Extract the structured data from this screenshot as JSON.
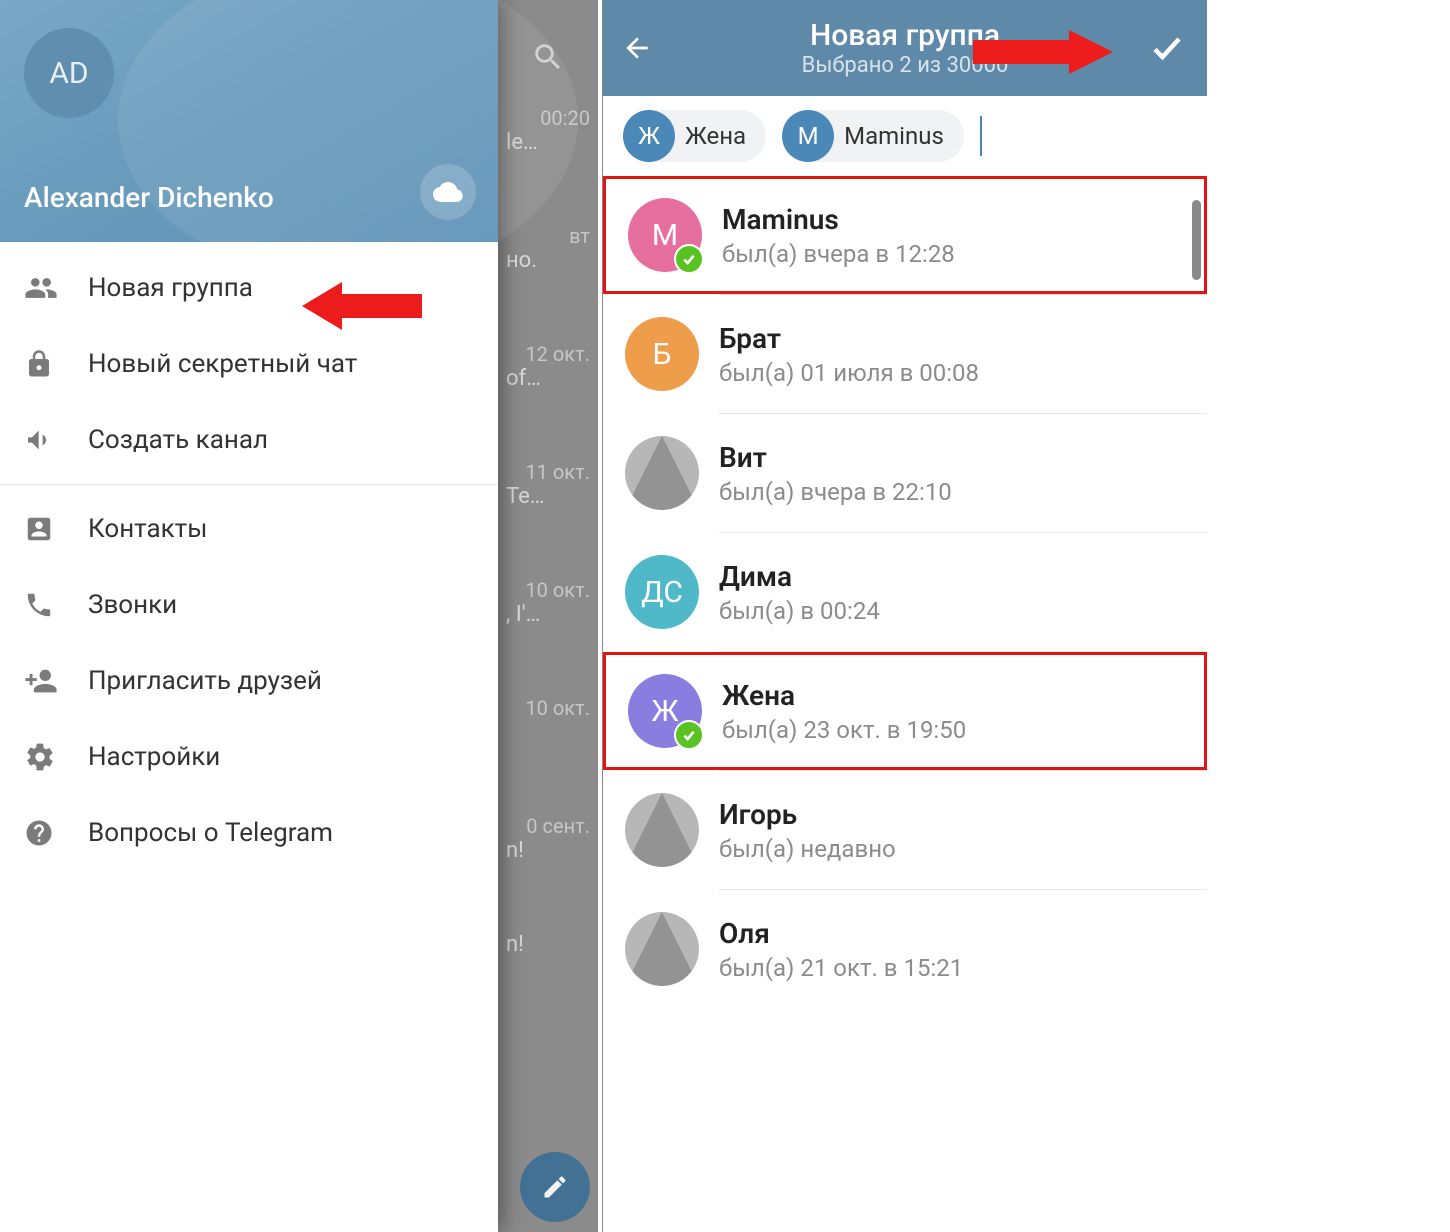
{
  "left": {
    "profile": {
      "initials": "AD",
      "name": "Alexander Dichenko"
    },
    "menu": [
      {
        "icon": "group",
        "label": "Новая группа"
      },
      {
        "icon": "lock",
        "label": "Новый секретный чат"
      },
      {
        "icon": "channel",
        "label": "Создать канал"
      },
      {
        "divider": true
      },
      {
        "icon": "contacts",
        "label": "Контакты"
      },
      {
        "icon": "call",
        "label": "Звонки"
      },
      {
        "icon": "invite",
        "label": "Пригласить друзей"
      },
      {
        "icon": "settings",
        "label": "Настройки"
      },
      {
        "icon": "help",
        "label": "Вопросы о Telegram"
      }
    ],
    "background_snippets": [
      {
        "time": "00:20",
        "text": "le…"
      },
      {
        "time": "вт",
        "text": "но."
      },
      {
        "time": "12 окт.",
        "text": "of…"
      },
      {
        "time": "11 окт.",
        "text": "Te…"
      },
      {
        "time": "10 окт.",
        "text": ", I'…"
      },
      {
        "time": "10 окт.",
        "text": ""
      },
      {
        "time": "0 сент.",
        "text": "n!"
      },
      {
        "time": "",
        "text": "n!"
      }
    ]
  },
  "right": {
    "header": {
      "title": "Новая группа",
      "subtitle": "Выбрано 2 из 30000"
    },
    "chips": [
      {
        "initial": "Ж",
        "label": "Жена",
        "color": "#4a88b7"
      },
      {
        "initial": "M",
        "label": "Maminus",
        "color": "#4a88b7"
      }
    ],
    "contacts": [
      {
        "name": "Maminus",
        "status": "был(а) вчера в 12:28",
        "avatar_text": "M",
        "avatar_color": "#e66fa0",
        "selected": true,
        "highlighted": true
      },
      {
        "name": "Брат",
        "status": "был(а) 01 июля в 00:08",
        "avatar_text": "Б",
        "avatar_color": "#ee9d4a",
        "selected": false,
        "highlighted": false
      },
      {
        "name": "Вит",
        "status": "был(а) вчера в 22:10",
        "avatar_text": "",
        "avatar_color": "photo",
        "selected": false,
        "highlighted": false
      },
      {
        "name": "Дима",
        "status": "был(а) в 00:24",
        "avatar_text": "ДС",
        "avatar_color": "#4fb8c9",
        "selected": false,
        "highlighted": false
      },
      {
        "name": "Жена",
        "status": "был(а) 23 окт. в 19:50",
        "avatar_text": "Ж",
        "avatar_color": "#8a7de0",
        "selected": true,
        "highlighted": true
      },
      {
        "name": "Игорь",
        "status": "был(а) недавно",
        "avatar_text": "",
        "avatar_color": "photo",
        "selected": false,
        "highlighted": false
      },
      {
        "name": "Оля",
        "status": "был(а) 21 окт. в 15:21",
        "avatar_text": "",
        "avatar_color": "photo",
        "selected": false,
        "highlighted": false
      }
    ]
  }
}
